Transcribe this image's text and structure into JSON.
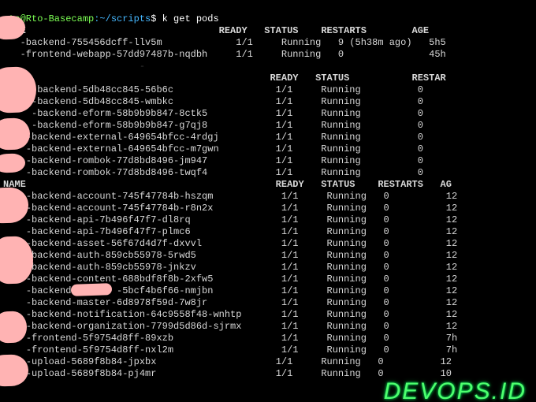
{
  "prompt": {
    "user_host": "rto@Rto-Basecamp",
    "path": ":~/scripts",
    "command": "k get pods"
  },
  "headers": {
    "name": "NAME",
    "ready": "READY",
    "status": "STATUS",
    "restarts": "RESTARTS",
    "restart_short": "RESTAR",
    "age": "AGE",
    "age_short": "AG"
  },
  "section1": [
    {
      "name": "-backend-755456dcff-llv5m",
      "ready": "1/1",
      "status": "Running",
      "restarts": "9 (5h38m ago)",
      "age": "5h5"
    },
    {
      "name": "-frontend-webapp-57dd97487b-nqdbh",
      "ready": "1/1",
      "status": "Running",
      "restarts": "0",
      "age": "45h"
    }
  ],
  "section2": [
    {
      "name": "-backend-5db48cc845-56b6c",
      "ready": "1/1",
      "status": "Running",
      "restarts": "0"
    },
    {
      "name": "-backend-5db48cc845-wmbkc",
      "ready": "1/1",
      "status": "Running",
      "restarts": "0"
    },
    {
      "name": "-backend-eform-58b9b9b847-8ctk5",
      "ready": "1/1",
      "status": "Running",
      "restarts": "0"
    },
    {
      "name": "-backend-eform-58b9b9b847-g7qj8",
      "ready": "1/1",
      "status": "Running",
      "restarts": "0"
    },
    {
      "name": "-backend-external-649654bfcc-4rdgj",
      "ready": "1/1",
      "status": "Running",
      "restarts": "0"
    },
    {
      "name": "-backend-external-649654bfcc-m7gwn",
      "ready": "1/1",
      "status": "Running",
      "restarts": "0"
    },
    {
      "name": "-backend-rombok-77d8bd8496-jm947",
      "ready": "1/1",
      "status": "Running",
      "restarts": "0"
    },
    {
      "name": "-backend-rombok-77d8bd8496-twqf4",
      "ready": "1/1",
      "status": "Running",
      "restarts": "0"
    }
  ],
  "section3": [
    {
      "name": "-backend-account-745f47784b-hszqm",
      "ready": "1/1",
      "status": "Running",
      "restarts": "0",
      "age": "12"
    },
    {
      "name": "-backend-account-745f47784b-r8n2x",
      "ready": "1/1",
      "status": "Running",
      "restarts": "0",
      "age": "12"
    },
    {
      "name": "-backend-api-7b496f47f7-dl8rq",
      "ready": "1/1",
      "status": "Running",
      "restarts": "0",
      "age": "12"
    },
    {
      "name": "-backend-api-7b496f47f7-plmc6",
      "ready": "1/1",
      "status": "Running",
      "restarts": "0",
      "age": "12"
    },
    {
      "name": "-backend-asset-56f67d4d7f-dxvvl",
      "ready": "1/1",
      "status": "Running",
      "restarts": "0",
      "age": "12"
    },
    {
      "name": "-backend-auth-859cb55978-5rwd5",
      "ready": "1/1",
      "status": "Running",
      "restarts": "0",
      "age": "12"
    },
    {
      "name": "-backend-auth-859cb55978-jnkzv",
      "ready": "1/1",
      "status": "Running",
      "restarts": "0",
      "age": "12"
    },
    {
      "name": "-backend-content-688bdf8f8b-2xfw5",
      "ready": "1/1",
      "status": "Running",
      "restarts": "0",
      "age": "12"
    },
    {
      "name": "-backend-       -5bcf4b6f66-nmjbn",
      "ready": "1/1",
      "status": "Running",
      "restarts": "0",
      "age": "12"
    },
    {
      "name": "-backend-master-6d8978f59d-7w8jr",
      "ready": "1/1",
      "status": "Running",
      "restarts": "0",
      "age": "12"
    },
    {
      "name": "-backend-notification-64c9558f48-wnhtp",
      "ready": "1/1",
      "status": "Running",
      "restarts": "0",
      "age": "12"
    },
    {
      "name": "-backend-organization-7799d5d86d-sjrmx",
      "ready": "1/1",
      "status": "Running",
      "restarts": "0",
      "age": "12"
    },
    {
      "name": "-frontend-5f9754d8ff-89xzb",
      "ready": "1/1",
      "status": "Running",
      "restarts": "0",
      "age": "7h"
    },
    {
      "name": "-frontend-5f9754d8ff-nxl2m",
      "ready": "1/1",
      "status": "Running",
      "restarts": "0",
      "age": "7h"
    },
    {
      "name": "-upload-5689f8b84-jpxbx",
      "ready": "1/1",
      "status": "Running",
      "restarts": "0",
      "age": "12"
    },
    {
      "name": "-upload-5689f8b84-pj4mr",
      "ready": "1/1",
      "status": "Running",
      "restarts": "0",
      "age": "10"
    }
  ],
  "brand": "DEVOPS.ID"
}
